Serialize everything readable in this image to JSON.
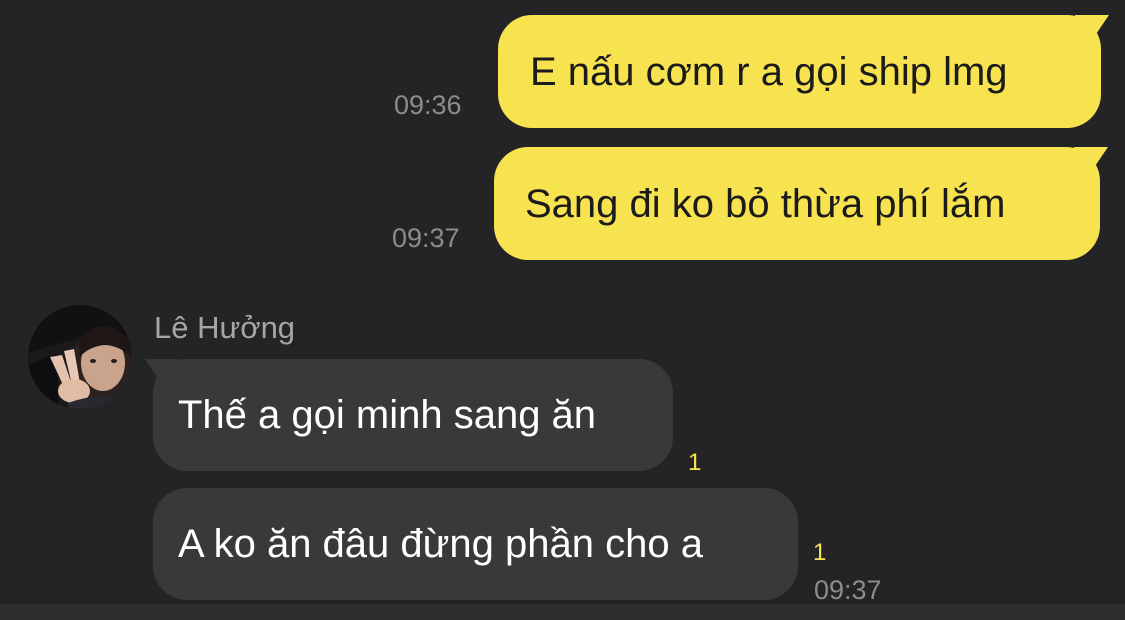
{
  "messages": [
    {
      "direction": "outgoing",
      "text": "E nấu cơm r a gọi ship lmg",
      "time": "09:36"
    },
    {
      "direction": "outgoing",
      "text": "Sang đi ko bỏ thừa phí lắm",
      "time": "09:37"
    },
    {
      "direction": "incoming",
      "sender": "Lê Hưởng",
      "text": "Thế a gọi minh sang ăn",
      "unread": "1"
    },
    {
      "direction": "incoming",
      "text": "A ko ăn đâu đừng phần cho a",
      "unread": "1",
      "time": "09:37"
    }
  ],
  "colors": {
    "background": "#242426",
    "outgoing_bubble": "#f7e34f",
    "incoming_bubble": "#39393b",
    "timestamp": "#8c8c8e",
    "unread_count": "#f7e34f",
    "sender_name": "#a5a5a7"
  },
  "icons": {
    "avatar": "contact-avatar-photo"
  }
}
